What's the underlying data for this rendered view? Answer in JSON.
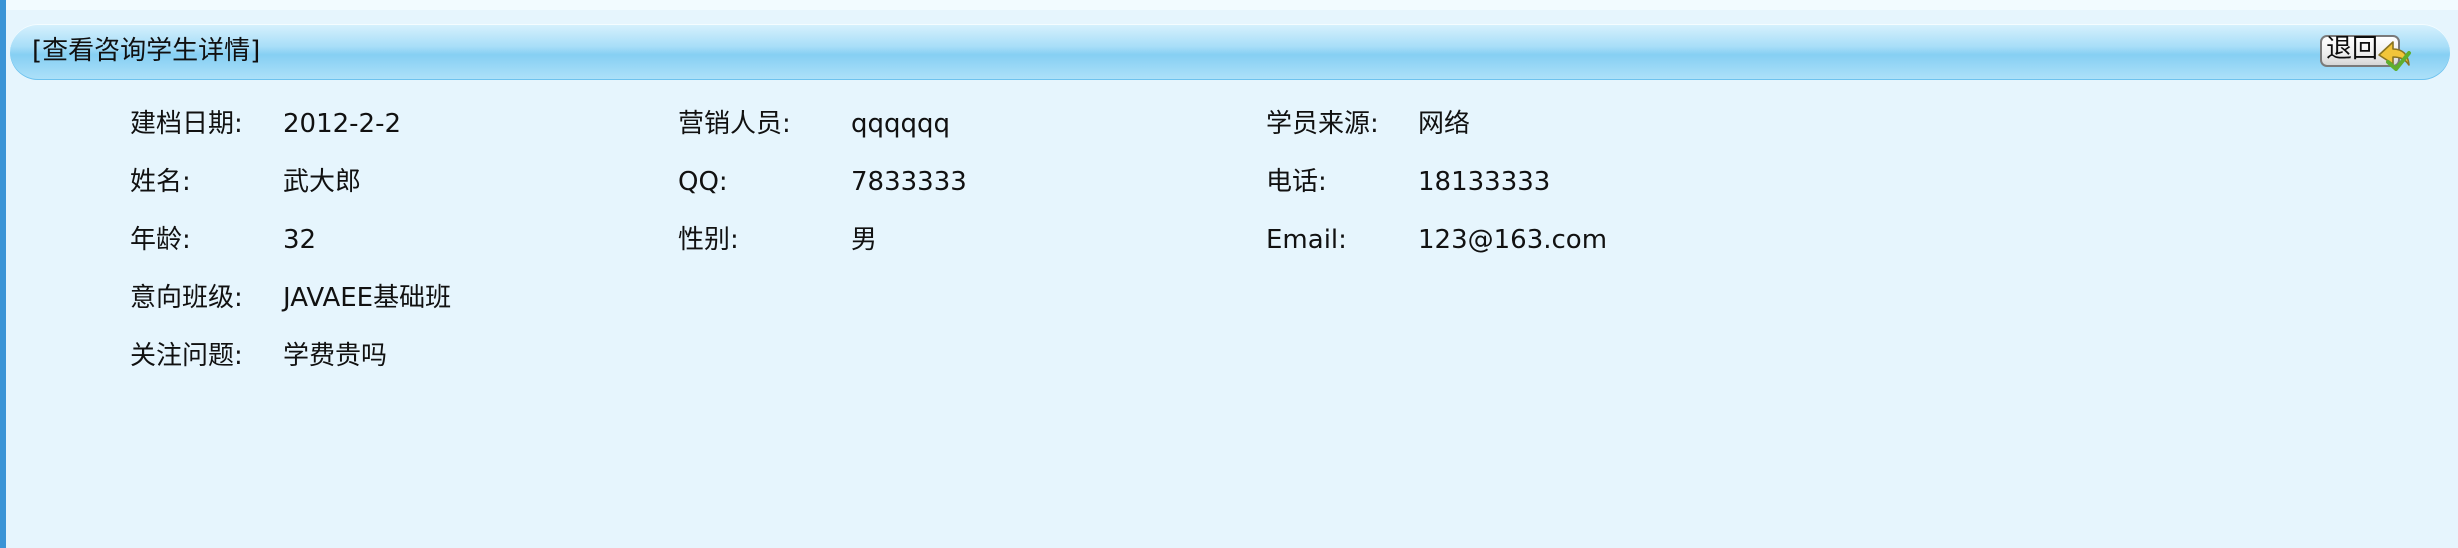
{
  "header": {
    "title": "[查看咨询学生详情]",
    "back_label": "退回"
  },
  "fields": {
    "row1": {
      "col1": {
        "label": "建档日期:",
        "value": "2012-2-2"
      },
      "col2": {
        "label": "营销人员:",
        "value": "qqqqqq"
      },
      "col3": {
        "label": "学员来源:",
        "value": "网络"
      }
    },
    "row2": {
      "col1": {
        "label": "姓名:",
        "value": "武大郎"
      },
      "col2": {
        "label": "QQ:",
        "value": "7833333"
      },
      "col3": {
        "label": "电话:",
        "value": "18133333"
      }
    },
    "row3": {
      "col1": {
        "label": "年龄:",
        "value": "32"
      },
      "col2": {
        "label": "性别:",
        "value": "男"
      },
      "col3": {
        "label": "Email:",
        "value": "123@163.com"
      }
    },
    "row4": {
      "col1": {
        "label": "意向班级:",
        "value": "JAVAEE基础班"
      }
    },
    "row5": {
      "col1": {
        "label": "关注问题:",
        "value": "学费贵吗"
      }
    }
  },
  "colors": {
    "background": "#e6f5fd",
    "title_bar": "#a8def8",
    "left_rail": "#3a94d6"
  },
  "icons": {
    "back": "return-arrow-icon"
  }
}
